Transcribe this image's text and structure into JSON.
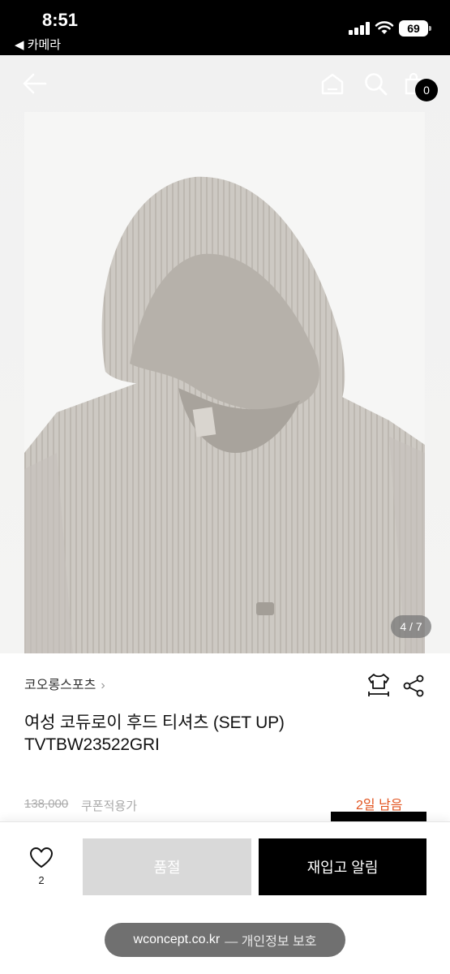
{
  "status_bar": {
    "time": "8:51",
    "back_app": "◀ 카메라",
    "battery": "69"
  },
  "header": {
    "cart_count": "0"
  },
  "gallery": {
    "counter": "4 / 7"
  },
  "product": {
    "brand": "코오롱스포츠",
    "brand_chevron": "›",
    "title_line1": "여성 코듀로이 후드 티셔츠 (SET UP)",
    "title_line2": "TVTBW23522GRI",
    "original_price": "138,000",
    "coupon_label": "쿠폰적용가",
    "days_left": "2일 남음"
  },
  "actions": {
    "like_count": "2",
    "soldout_label": "품절",
    "restock_label": "재입고 알림"
  },
  "browser": {
    "domain": "wconcept.co.kr",
    "privacy_note": "— 개인정보 보호"
  },
  "colors": {
    "accent_orange": "#e2531e",
    "soldout_gray": "#d9d9d9",
    "primary_black": "#000000",
    "hoodie_gray": "#cfcbc6"
  }
}
